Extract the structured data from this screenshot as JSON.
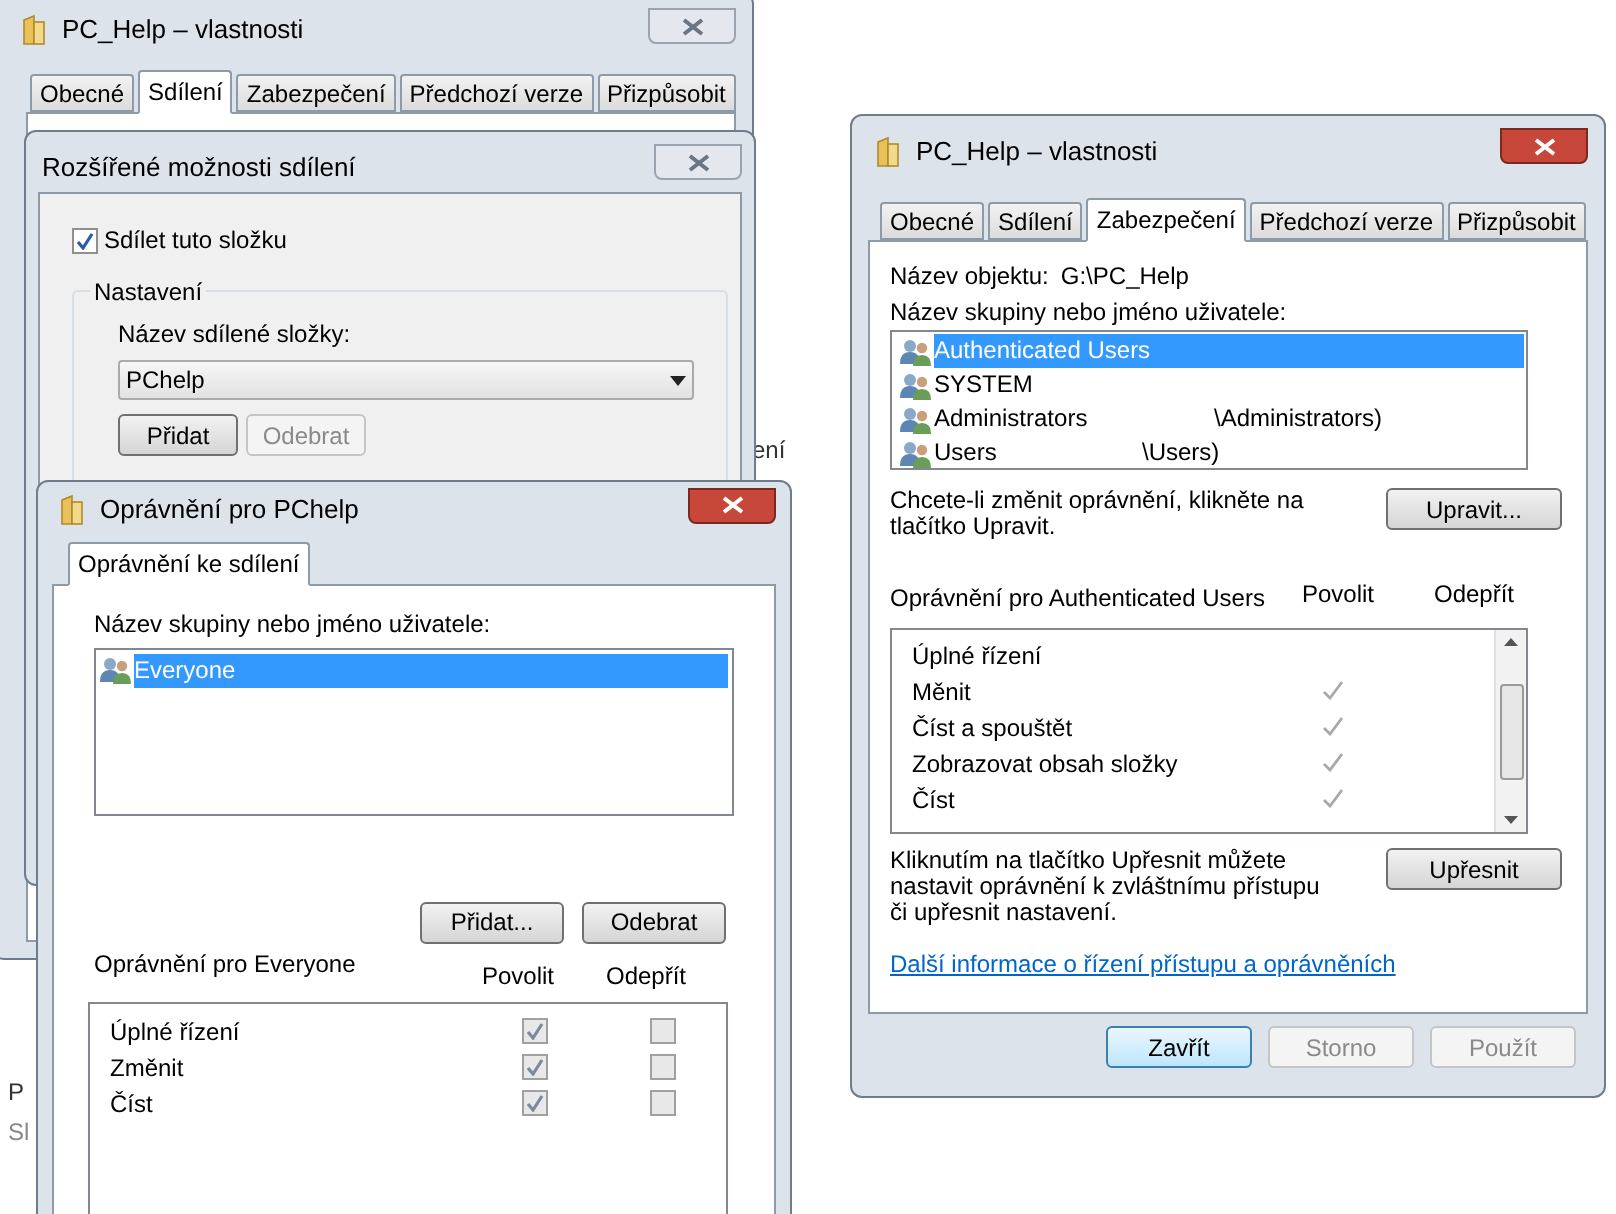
{
  "back_properties": {
    "title": "PC_Help – vlastnosti",
    "tabs": [
      {
        "label": "Obecné",
        "selected": false
      },
      {
        "label": "Sdílení",
        "selected": true
      },
      {
        "label": "Zabezpečení",
        "selected": false
      },
      {
        "label": "Předchozí verze",
        "selected": false
      },
      {
        "label": "Přizpůsobit",
        "selected": false
      }
    ]
  },
  "advanced_sharing": {
    "title": "Rozšířené možnosti sdílení",
    "share_folder": {
      "label": "Sdílet tuto složku",
      "checked": true
    },
    "settings_group": "Nastavení",
    "share_name_label": "Název sdílené složky:",
    "share_name_value": "PChelp",
    "buttons": [
      {
        "label": "Přidat",
        "disabled": false
      },
      {
        "label": "Odebrat",
        "disabled": true
      }
    ]
  },
  "share_permissions": {
    "title": "Oprávnění pro PChelp",
    "tabs": [
      {
        "label": "Oprávnění ke sdílení",
        "selected": true
      }
    ],
    "users_label": "Název skupiny nebo jméno uživatele:",
    "users": [
      {
        "name": "Everyone",
        "selected": true
      }
    ],
    "buttons": [
      "Přidat...",
      "Odebrat"
    ],
    "permissions_label": "Oprávnění pro Everyone",
    "columns": [
      "Povolit",
      "Odepřít"
    ],
    "permissions": [
      {
        "name": "Úplné řízení",
        "allow": true,
        "deny": false
      },
      {
        "name": "Změnit",
        "allow": true,
        "deny": false
      },
      {
        "name": "Číst",
        "allow": true,
        "deny": false
      }
    ]
  },
  "security_properties": {
    "title": "PC_Help – vlastnosti",
    "tabs": [
      {
        "label": "Obecné",
        "selected": false
      },
      {
        "label": "Sdílení",
        "selected": false
      },
      {
        "label": "Zabezpečení",
        "selected": true
      },
      {
        "label": "Předchozí verze",
        "selected": false
      },
      {
        "label": "Přizpůsobit",
        "selected": false
      }
    ],
    "object_label": "Název objektu:",
    "object_value": "G:\\PC_Help",
    "users_label": "Název skupiny nebo jméno uživatele:",
    "users": [
      {
        "name": "Authenticated Users",
        "selected": true
      },
      {
        "name": "SYSTEM",
        "selected": false
      },
      {
        "name": "Administrators",
        "path": "\\Administrators)",
        "selected": false
      },
      {
        "name": "Users",
        "path": "\\Users)",
        "selected": false
      }
    ],
    "edit_hint": "Chcete-li změnit oprávnění, klikněte na tlačítko Upravit.",
    "edit_button": "Upravit...",
    "permissions_label": "Oprávnění pro Authenticated Users",
    "columns": [
      "Povolit",
      "Odepřít"
    ],
    "permissions": [
      {
        "name": "Úplné řízení",
        "allow": false
      },
      {
        "name": "Měnit",
        "allow": true
      },
      {
        "name": "Číst a spouštět",
        "allow": true
      },
      {
        "name": "Zobrazovat obsah složky",
        "allow": true
      },
      {
        "name": "Číst",
        "allow": true
      }
    ],
    "advanced_hint": "Kliknutím na tlačítko Upřesnit můžete nastavit oprávnění k zvláštnímu přístupu či upřesnit nastavení.",
    "advanced_button": "Upřesnit",
    "link": "Další informace o řízení přístupu a oprávněních",
    "buttons": [
      {
        "label": "Zavřít",
        "default": true,
        "disabled": false
      },
      {
        "label": "Storno",
        "default": false,
        "disabled": true
      },
      {
        "label": "Použít",
        "default": false,
        "disabled": true
      }
    ]
  },
  "background_text": [
    "ení",
    "P",
    "Sl"
  ]
}
